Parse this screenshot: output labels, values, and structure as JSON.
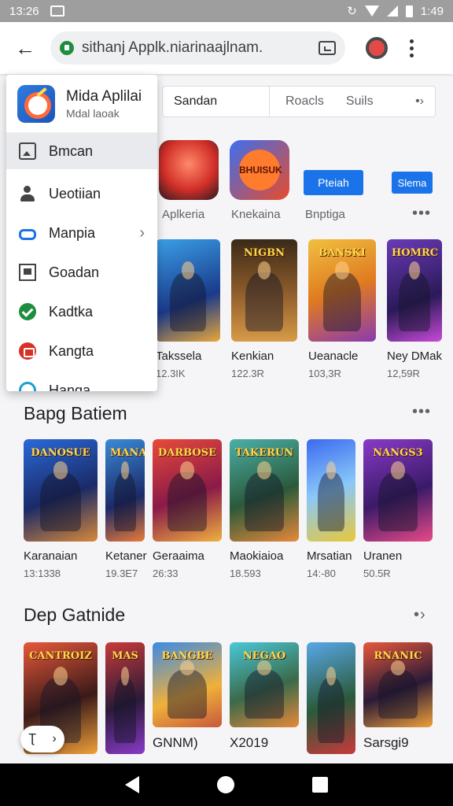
{
  "status": {
    "time": "13:26",
    "right_time": "1:49",
    "sync_glyph": "↻"
  },
  "browser": {
    "url": "sithanj Applk.niarinaajlnam.",
    "back_glyph": "←"
  },
  "menu": {
    "header": {
      "title": "Mida Aplilai",
      "subtitle": "Mdal laoak"
    },
    "items": [
      {
        "label": "Bmcan",
        "icon": "image-icon"
      },
      {
        "label": "Ueotiian",
        "icon": "people-icon"
      },
      {
        "label": "Manpia",
        "icon": "link-icon"
      },
      {
        "label": "Goadan",
        "icon": "news-icon"
      },
      {
        "label": "Kadtka",
        "icon": "check-icon"
      },
      {
        "label": "Kangta",
        "icon": "red-badge-icon"
      },
      {
        "label": "Hanga",
        "icon": "blue-ring-icon"
      }
    ],
    "chevron": "›"
  },
  "tabs": {
    "t1": "Sandan",
    "t2": "Roacls",
    "t3": "Suils",
    "t4": "•›"
  },
  "top_apps": {
    "labels": [
      "Aplkeria",
      "Knekaina",
      "Bnptiga"
    ],
    "app2_text": "BHUISUK",
    "pill1": "Pteiah",
    "pill2": "Slema"
  },
  "more": "•••",
  "row1": [
    {
      "name": "Takssela",
      "size": "12.3IK",
      "title": ""
    },
    {
      "name": "Kenkian",
      "size": "122.3R",
      "title": "NIGBN"
    },
    {
      "name": "Ueanacle",
      "size": "103,3R",
      "title": "BANSKI"
    },
    {
      "name": "Ney DMak",
      "size": "12,59R",
      "title": "HOMRC"
    }
  ],
  "section2": {
    "title": "Bapg Batiem"
  },
  "row2": [
    {
      "name": "Karanaian",
      "size": "13:1338",
      "title": "DANOSUE"
    },
    {
      "name": "Ketaner",
      "size": "19.3E7",
      "title": "MANA"
    },
    {
      "name": "Geraaima",
      "size": "26:33",
      "title": "DARBOSE"
    },
    {
      "name": "Maokiaioa",
      "size": "18.593",
      "title": "TAKERUN"
    },
    {
      "name": "Mrsatian",
      "size": "14:-80",
      "title": ""
    },
    {
      "name": "Uranen",
      "size": "50.5R",
      "title": "NANGS3"
    }
  ],
  "section3": {
    "title": "Dep Gatnide",
    "arrow": "•›"
  },
  "row3": [
    {
      "name": "",
      "title": "CANTROIZ"
    },
    {
      "name": "",
      "title": "MAS"
    },
    {
      "name": "GNNM)",
      "title": "BANGBE"
    },
    {
      "name": "X2019",
      "title": "NEGAO"
    },
    {
      "name": "",
      "title": ""
    },
    {
      "name": "Sarsgi9",
      "title": "RNANIC"
    }
  ],
  "fab": {
    "left": "Ʈ",
    "right": "›"
  },
  "colors": {
    "accent": "#1a73e8",
    "statusbar": "#9e9e9e"
  }
}
